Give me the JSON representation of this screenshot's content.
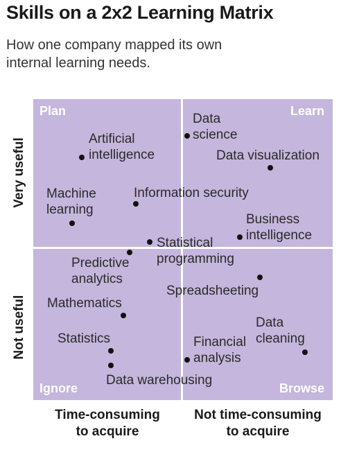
{
  "title": "Skills on a 2x2 Learning Matrix",
  "subtitle": "How one company mapped its own internal learning needs.",
  "colors": {
    "quadrant_fill": "#c4b6dc",
    "divider": "#ffffff",
    "dot": "#111111"
  },
  "quadrants": {
    "top_left": "Plan",
    "top_right": "Learn",
    "bottom_left": "Ignore",
    "bottom_right": "Browse"
  },
  "axes": {
    "y_top": "Very useful",
    "y_bottom": "Not useful",
    "x_left": [
      "Time-consuming",
      "to acquire"
    ],
    "x_right": [
      "Not time-consuming",
      "to acquire"
    ]
  },
  "skills": [
    {
      "id": "data-science",
      "lines": [
        "Data",
        "science"
      ]
    },
    {
      "id": "artificial-intelligence",
      "lines": [
        "Artificial",
        "intelligence"
      ]
    },
    {
      "id": "data-visualization",
      "lines": [
        "Data visualization"
      ]
    },
    {
      "id": "machine-learning",
      "lines": [
        "Machine",
        "learning"
      ]
    },
    {
      "id": "information-security",
      "lines": [
        "Information security"
      ]
    },
    {
      "id": "business-intelligence",
      "lines": [
        "Business",
        "intelligence"
      ]
    },
    {
      "id": "statistical-programming",
      "lines": [
        "Statistical",
        "programming"
      ]
    },
    {
      "id": "predictive-analytics",
      "lines": [
        "Predictive",
        "analytics"
      ]
    },
    {
      "id": "spreadsheeting",
      "lines": [
        "Spreadsheeting"
      ]
    },
    {
      "id": "mathematics",
      "lines": [
        "Mathematics"
      ]
    },
    {
      "id": "data-cleaning",
      "lines": [
        "Data",
        "cleaning"
      ]
    },
    {
      "id": "statistics",
      "lines": [
        "Statistics"
      ]
    },
    {
      "id": "financial-analysis",
      "lines": [
        "Financial",
        "analysis"
      ]
    },
    {
      "id": "data-warehousing",
      "lines": [
        "Data warehousing"
      ]
    }
  ]
}
